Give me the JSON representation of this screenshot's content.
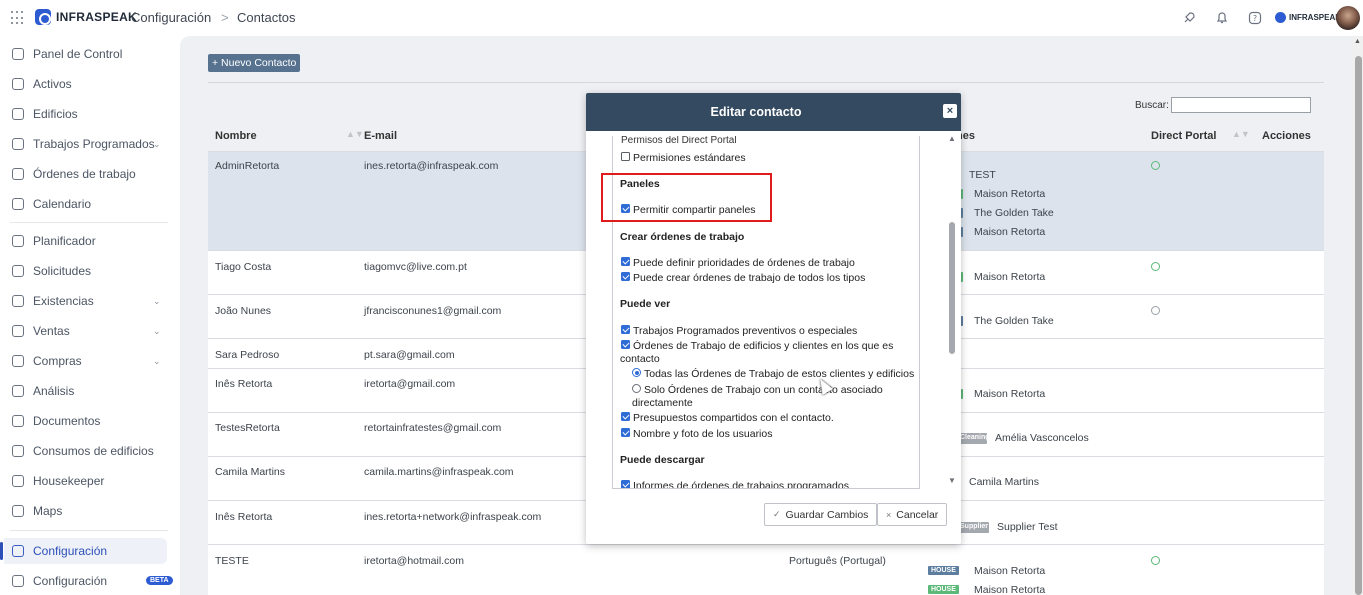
{
  "topbar": {
    "logo_text": "INFRASPEAK",
    "breadcrumb_1": "Configuración",
    "breadcrumb_sep": ">",
    "breadcrumb_2": "Contactos",
    "brand_small": "INFRASPEAK",
    "icons": [
      "grid-icon",
      "rocket-icon",
      "bell-icon",
      "help-icon"
    ]
  },
  "sidebar": {
    "items": [
      {
        "label": "Panel de Control",
        "icon": "dashboard-icon"
      },
      {
        "label": "Activos",
        "icon": "assets-icon"
      },
      {
        "label": "Edificios",
        "icon": "building-icon"
      },
      {
        "label": "Trabajos Programados",
        "icon": "calendar-clock-icon",
        "chevron": "⌄"
      },
      {
        "label": "Órdenes de trabajo",
        "icon": "clipboard-icon"
      },
      {
        "label": "Calendario",
        "icon": "calendar-icon"
      },
      {
        "label": "Planificador",
        "icon": "planner-icon"
      },
      {
        "label": "Solicitudes",
        "icon": "inbox-icon"
      },
      {
        "label": "Existencias",
        "icon": "stock-icon",
        "chevron": "⌄"
      },
      {
        "label": "Ventas",
        "icon": "tag-icon",
        "chevron": "⌄"
      },
      {
        "label": "Compras",
        "icon": "cart-icon",
        "chevron": "⌄"
      },
      {
        "label": "Análisis",
        "icon": "analytics-icon"
      },
      {
        "label": "Documentos",
        "icon": "document-icon"
      },
      {
        "label": "Consumos de edificios",
        "icon": "bolt-icon"
      },
      {
        "label": "Housekeeper",
        "icon": "bed-icon"
      },
      {
        "label": "Maps",
        "icon": "map-pin-icon"
      },
      {
        "label": "Configuración",
        "icon": "gear-icon"
      },
      {
        "label": "Configuración",
        "icon": "gear-icon",
        "badge": "BETA"
      }
    ]
  },
  "main": {
    "new_contact_button": "+ Nuevo Contacto",
    "search_label": "Buscar:",
    "search_value": "",
    "columns": {
      "name": "Nombre",
      "email": "E-mail",
      "partial": "nes",
      "direct_portal": "Direct Portal",
      "actions": "Acciones"
    },
    "rows": [
      {
        "name": "AdminRetorta",
        "email": "ines.retorta@infraspeak.com",
        "language": "",
        "spaces": [
          "TEST",
          "Maison Retorta",
          "The Golden Take",
          "Maison Retorta"
        ]
      },
      {
        "name": "Tiago Costa",
        "email": "tiagomvc@live.com.pt",
        "language": "",
        "spaces": [
          "Maison Retorta"
        ]
      },
      {
        "name": "João Nunes",
        "email": "jfranciscon‌unes1@gmail.com",
        "language": "",
        "spaces": [
          "The Golden Take"
        ]
      },
      {
        "name": "Sara Pedroso",
        "email": "pt.sara@gmail.com",
        "language": "",
        "spaces": []
      },
      {
        "name": "Inês Retorta",
        "email": "iretorta@gmail.com",
        "language": "",
        "spaces": [
          "Maison Retorta"
        ]
      },
      {
        "name": "TestesRetorta",
        "email": "retortainfratestes@gmail.com",
        "language": "",
        "spaces": [
          "Amélia Vasconcelos"
        ]
      },
      {
        "name": "Camila Martins",
        "email": "camila.martins@infraspeak.com",
        "language": "",
        "spaces": [
          "Camila Martins"
        ]
      },
      {
        "name": "Inês Retorta",
        "email": "ines.retorta+network@infraspeak.com",
        "language": "",
        "spaces": [
          "Supplier Test"
        ]
      },
      {
        "name": "TESTE",
        "email": "iretorta@hotmail.com",
        "language": "Português (Portugal)",
        "spaces": [
          "Maison Retorta",
          "Maison Retorta"
        ]
      }
    ],
    "tags": {
      "cleaning": "Cleaning",
      "supplier": "Supplier Test",
      "house": "HOUSE"
    }
  },
  "modal": {
    "title": "Editar contacto",
    "close": "×",
    "fieldset_legend": "Permisos del Direct Portal",
    "standard_permissions": "Permisiones estándares",
    "section_panels": "Paneles",
    "allow_share_panels": "Permitir compartir paneles",
    "section_create_wo": "Crear órdenes de trabajo",
    "define_priorities": "Puede definir prioridades de órdenes de trabajo",
    "create_all_types": "Puede crear órdenes de trabajo de todos los tipos",
    "section_can_see": "Puede ver",
    "see_scheduled": "Trabajos Programados preventivos o especiales",
    "see_wo_line1": "Órdenes de Trabajo de edificios y clientes en los que es",
    "see_wo_line2": "contacto",
    "radio_all": "Todas las Órdenes de Trabajo de estos clientes y edificios",
    "radio_only_line1": "Solo Órdenes de Trabajo con un contacto asociado",
    "radio_only_line2": "directamente",
    "see_quotes": "Presupuestos compartidos con el contacto.",
    "see_users": "Nombre y foto de los usuarios",
    "section_download": "Puede descargar",
    "download_reports": "Informes de órdenes de trabajos programados",
    "save_button": "Guardar Cambios",
    "cancel_button": "Cancelar",
    "checks": {
      "standard": false,
      "share_panels": true,
      "priorities": true,
      "all_types": true,
      "scheduled": true,
      "wo_buildings": true,
      "quotes": true,
      "users": true,
      "reports": true
    },
    "radio_selected": "all"
  }
}
